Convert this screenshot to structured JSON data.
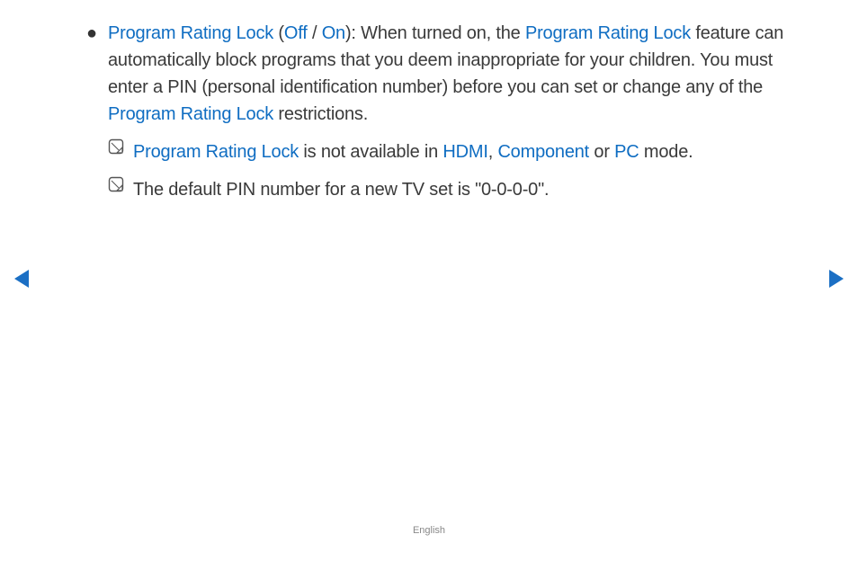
{
  "item": {
    "title": "Program Rating Lock",
    "opt_off": "Off",
    "opt_on": "On",
    "desc_part1": "): When turned on, the ",
    "title_repeat": "Program Rating Lock",
    "desc_part2": " feature can automatically block programs that you deem inappropriate for your children. You must enter a PIN (personal identification number) before you can set or change any of the ",
    "title_repeat2": "Program Rating Lock",
    "desc_part3": " restrictions."
  },
  "note1": {
    "term": "Program Rating Lock",
    "mid": " is not available in ",
    "hdmi": "HDMI",
    "comp": "Component",
    "pc": "PC",
    "tail": " mode."
  },
  "note2": {
    "text": "The default PIN number for a new TV set is \"0-0-0-0\"."
  },
  "footer": "English",
  "punct": {
    "open_paren": " (",
    "slash": " / ",
    "comma_sp": ", ",
    "or": " or "
  }
}
